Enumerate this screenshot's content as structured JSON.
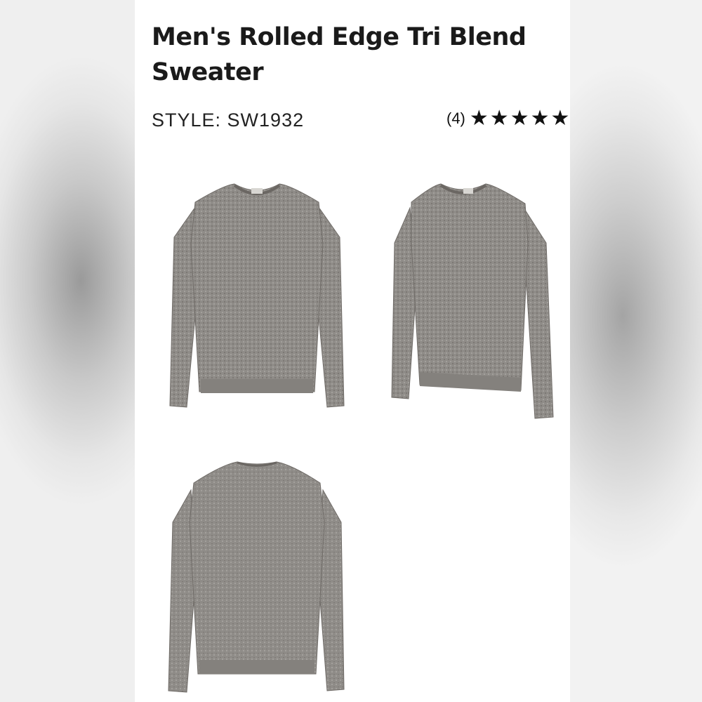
{
  "product": {
    "title": "Men's Rolled Edge Tri Blend Sweater",
    "style_label": "STYLE: SW1932",
    "review_count": "(4)",
    "rating_stars": 4.5
  },
  "images": [
    {
      "view": "front",
      "icon": "sweater-front-image"
    },
    {
      "view": "side",
      "icon": "sweater-side-image"
    },
    {
      "view": "back",
      "icon": "sweater-back-image"
    }
  ],
  "colors": {
    "sweater": "#8f8c88",
    "sweater_light": "#a9a6a2",
    "sweater_dark": "#76726e",
    "text": "#1a1a1a"
  }
}
